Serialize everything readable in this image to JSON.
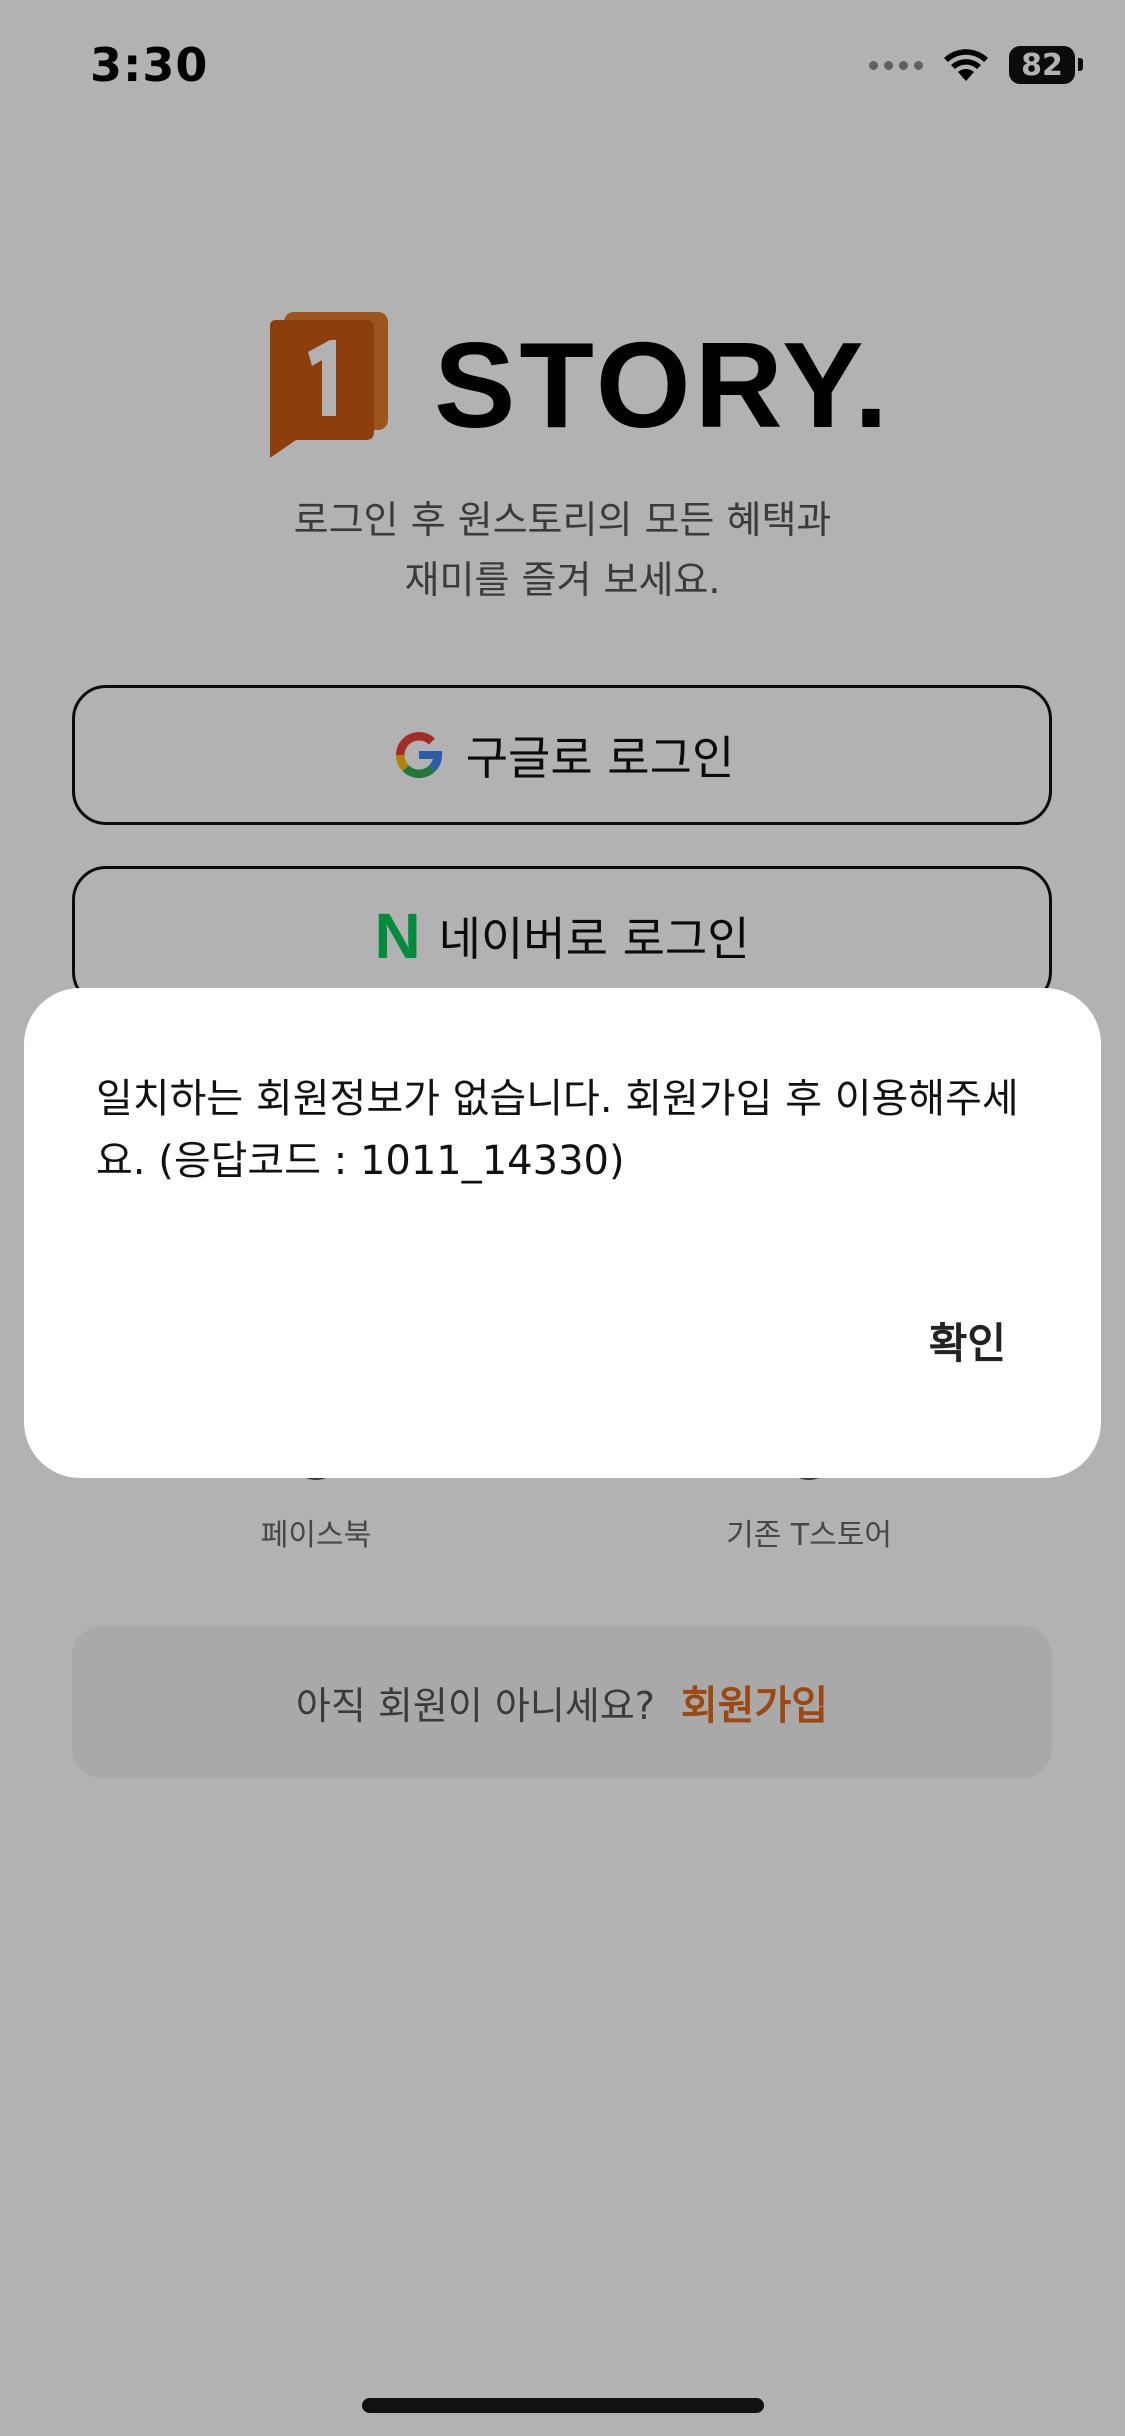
{
  "status_bar": {
    "time": "3:30",
    "battery": "82"
  },
  "brand": {
    "name": "STORY.",
    "accent_color": "#c95a12"
  },
  "tagline": {
    "line1": "로그인 후 원스토리의 모든 혜택과",
    "line2": "재미를 즐겨 보세요."
  },
  "login": {
    "google_label": "구글로 로그인",
    "naver_label": "네이버로 로그인",
    "naver_icon_letter": "N",
    "facebook_label": "페이스북",
    "tstore_label": "기존 T스토어"
  },
  "signup": {
    "prompt": "아직 회원이 아니세요?",
    "link_label": "회원가입"
  },
  "dialog": {
    "message": "일치하는 회원정보가 없습니다. 회원가입 후 이용해주세요. (응답코드 : 1011_14330)",
    "confirm_label": "확인"
  },
  "icons": [
    "wifi-icon",
    "battery-icon",
    "google-icon",
    "naver-icon",
    "facebook-icon",
    "tstore-icon",
    "onestore-logo-icon"
  ]
}
